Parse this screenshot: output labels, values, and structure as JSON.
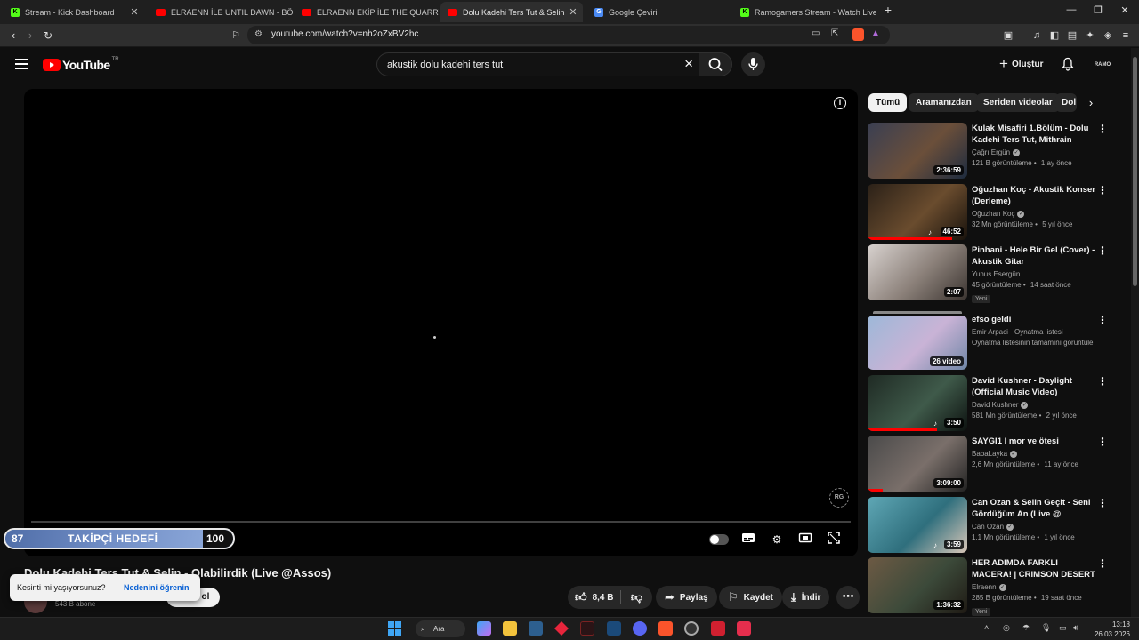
{
  "browser": {
    "tabs": [
      {
        "title": "Stream - Kick Dashboard",
        "icon": "kick-icon",
        "active": false
      },
      {
        "title": "ELRAENN İLE UNTIL DAWN - BÖLÜM",
        "icon": "youtube-icon",
        "active": false
      },
      {
        "title": "ELRAENN EKİP İLE THE QUARRY OYN",
        "icon": "youtube-icon",
        "active": false
      },
      {
        "title": "Dolu Kadehi Ters Tut & Selin - Ol",
        "icon": "youtube-icon",
        "active": true
      },
      {
        "title": "Google Çeviri",
        "icon": "google-translate-icon",
        "active": false
      },
      {
        "title": "Ramogamers Stream - Watch Live on",
        "icon": "kick-icon",
        "active": false
      }
    ],
    "url": "youtube.com/watch?v=nh2oZxBV2hc"
  },
  "youtube": {
    "logo_text": "YouTube",
    "country_code": "TR",
    "search_query": "akustik dolu kadehi ters tut",
    "create_label": "Oluştur",
    "avatar_text": "RAMO"
  },
  "player": {
    "goal": {
      "current": "87",
      "label": "TAKİPÇİ HEDEFİ",
      "target": "100",
      "progress_fraction": 0.87
    },
    "watermark_text": "RG"
  },
  "video": {
    "title": "Dolu Kadehi Ters Tut & Selin - Olabilirdik (Live @Assos)",
    "subscribers": "543 B abone",
    "likes": "8,4 B",
    "share_label": "Paylaş",
    "save_label": "Kaydet",
    "download_label": "İndir",
    "join_label": "ol"
  },
  "toast": {
    "text": "Kesinti mi yaşıyorsunuz?",
    "link": "Nedenini öğrenin"
  },
  "chips": [
    "Tümü",
    "Aramanızdan",
    "Seriden videolar",
    "Dol"
  ],
  "recommendations": [
    {
      "title": "Kulak Misafiri 1.Bölüm - Dolu Kadehi Ters Tut, Mithrain",
      "channel": "Çağrı Ergün",
      "verified": true,
      "views": "121 B görüntüleme",
      "age": "1 ay önce",
      "duration": "2:36:59",
      "watched_fraction": 0,
      "badge": "",
      "thumb": [
        "#3a3f52",
        "#6b4f3a",
        "#1d2b3f"
      ]
    },
    {
      "title": "Oğuzhan Koç - Akustik Konser (Derleme)",
      "channel": "Oğuzhan Koç",
      "verified": true,
      "views": "32 Mn görüntüleme",
      "age": "5 yıl önce",
      "duration": "46:52",
      "music": true,
      "watched_fraction": 0.85,
      "badge": "",
      "thumb": [
        "#2b2118",
        "#6a4c2e",
        "#18120c"
      ]
    },
    {
      "title": "Pinhani - Hele Bir Gel (Cover) - Akustik Gitar",
      "channel": "Yunus Esergün",
      "verified": false,
      "views": "45 görüntüleme",
      "age": "14 saat önce",
      "duration": "2:07",
      "watched_fraction": 0,
      "badge": "Yeni",
      "thumb": [
        "#d8d2cf",
        "#8a7f78",
        "#3b3430"
      ]
    },
    {
      "title": "efso geldi",
      "channel": "Emir Arpaci · Oynatma listesi",
      "verified": false,
      "views": "Oynatma listesinin tamamını görüntüle",
      "age": "",
      "duration": "26 video",
      "watched_fraction": 0,
      "badge": "",
      "playlist": true,
      "thumb": [
        "#9db8d8",
        "#c9b3d6",
        "#6f86a6"
      ]
    },
    {
      "title": "David Kushner - Daylight (Official Music Video)",
      "channel": "David Kushner",
      "verified": true,
      "views": "581 Mn görüntüleme",
      "age": "2 yıl önce",
      "duration": "3:50",
      "music": true,
      "watched_fraction": 0.7,
      "badge": "",
      "thumb": [
        "#1f2a24",
        "#3f5a4a",
        "#0d1210"
      ]
    },
    {
      "title": "SAYGI1 l mor ve ötesi",
      "channel": "BabaLayka",
      "verified": true,
      "views": "2,6 Mn görüntüleme",
      "age": "11 ay önce",
      "duration": "3:09:00",
      "watched_fraction": 0.15,
      "badge": "",
      "thumb": [
        "#4a4a4a",
        "#7a6f6a",
        "#222"
      ]
    },
    {
      "title": "Can Ozan & Selin Geçit - Seni Gördüğüm An (Live @ Bostanc...",
      "channel": "Can Ozan",
      "verified": true,
      "views": "1,1 Mn görüntüleme",
      "age": "1 yıl önce",
      "duration": "3:59",
      "music": true,
      "watched_fraction": 0,
      "badge": "",
      "thumb": [
        "#5fa7b5",
        "#2f6f7d",
        "#d9c7b8"
      ]
    },
    {
      "title": "HER ADIMDA FARKLI MACERA! | CRIMSON DESERT |",
      "channel": "Elraenn",
      "verified": true,
      "views": "285 B görüntüleme",
      "age": "19 saat önce",
      "duration": "1:36:32",
      "watched_fraction": 0,
      "badge": "Yeni",
      "thumb": [
        "#6d5a44",
        "#3c4a3a",
        "#1f1a14"
      ]
    }
  ],
  "taskbar": {
    "search_label": "Ara",
    "time": "13:18",
    "date": "26.03.2026"
  }
}
